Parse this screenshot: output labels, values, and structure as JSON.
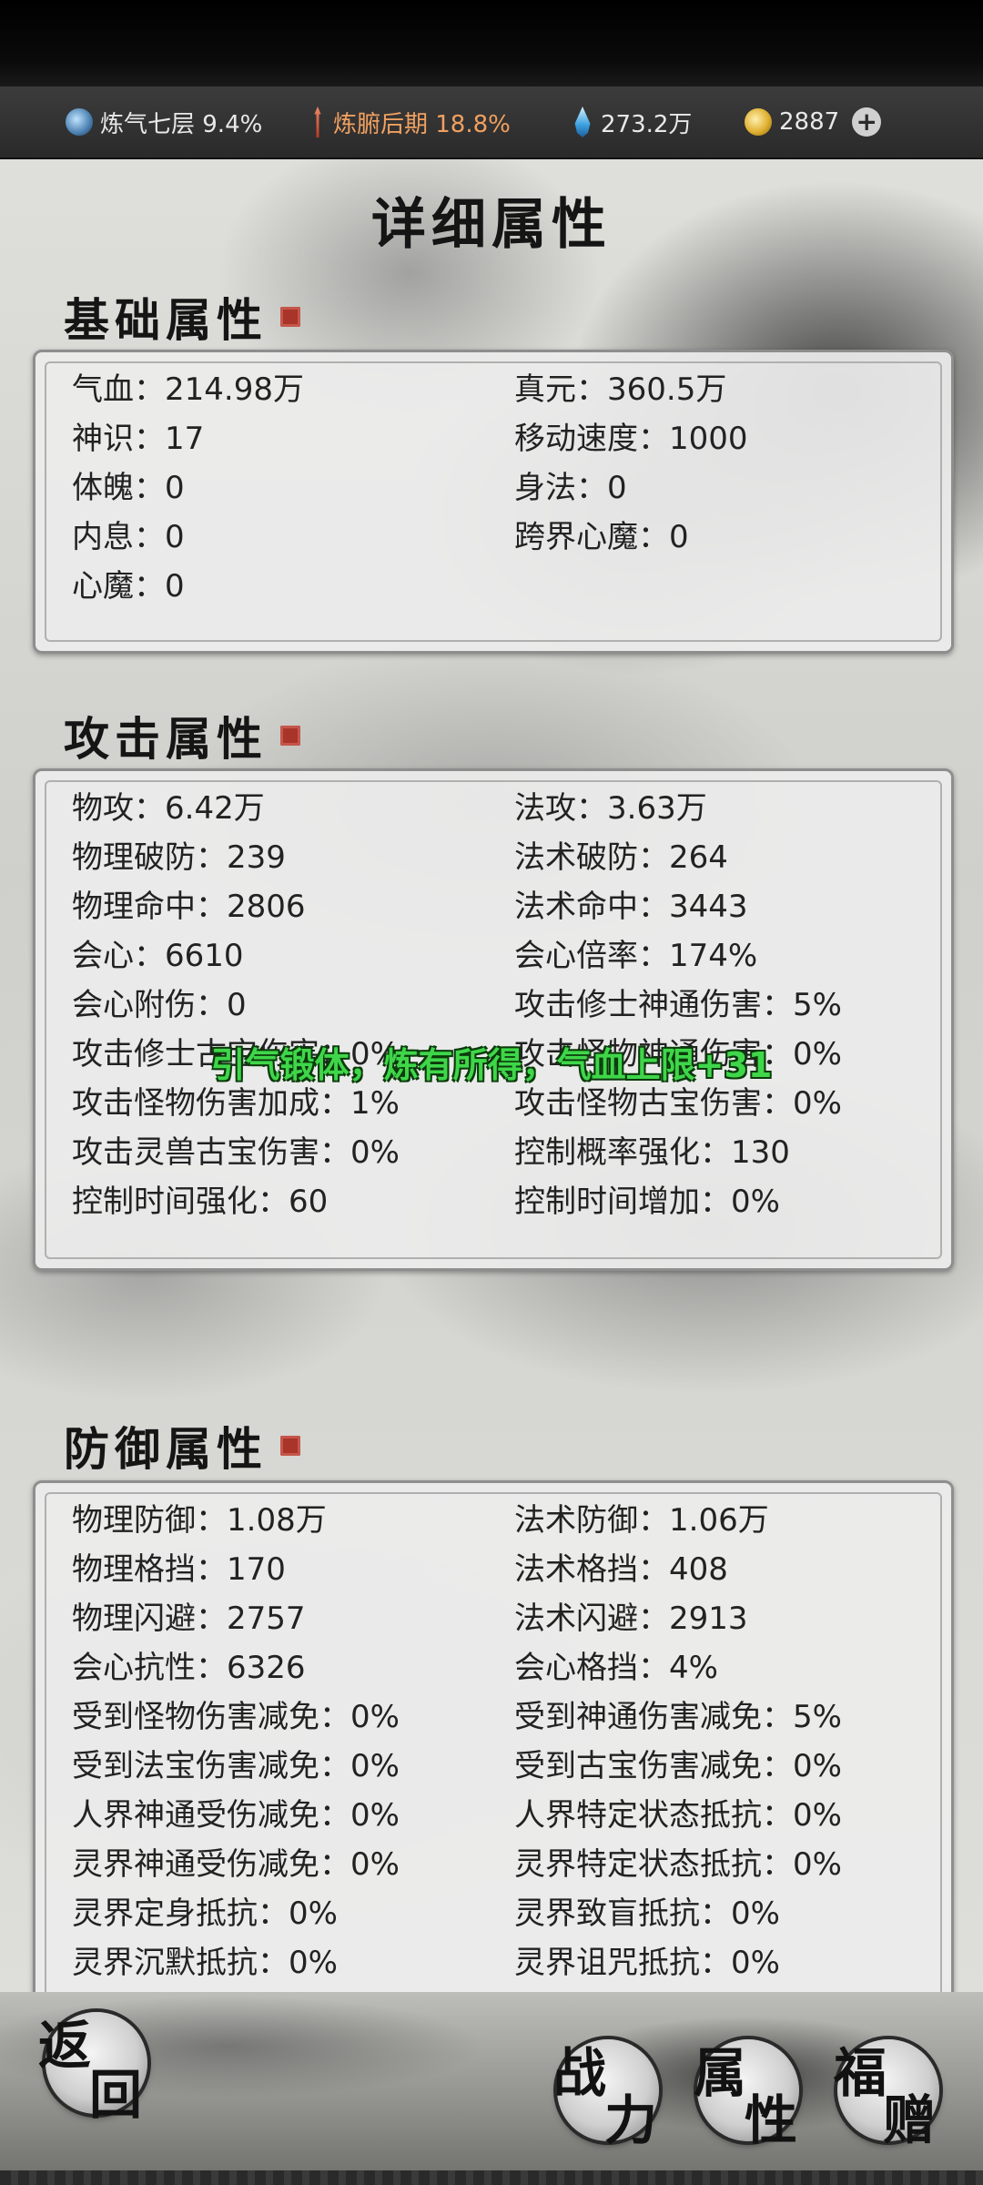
{
  "resources": {
    "cultivation": "炼气七层 9.4%",
    "body_realm": "炼腑后期 18.8%",
    "spirit_stone": "273.2万",
    "coins": "2887"
  },
  "page_title": "详细属性",
  "basic": {
    "title": "基础属性",
    "rows": [
      [
        "气血：214.98万",
        "真元：360.5万"
      ],
      [
        "神识：17",
        "移动速度：1000"
      ],
      [
        "体魄：0",
        "身法：0"
      ],
      [
        "内息：0",
        "跨界心魔：0"
      ],
      [
        "心魔：0",
        ""
      ]
    ]
  },
  "attack": {
    "title": "攻击属性",
    "rows": [
      [
        "物攻：6.42万",
        "法攻：3.63万"
      ],
      [
        "物理破防：239",
        "法术破防：264"
      ],
      [
        "物理命中：2806",
        "法术命中：3443"
      ],
      [
        "会心：6610",
        "会心倍率：174%"
      ],
      [
        "会心附伤：0",
        "攻击修士神通伤害：5%"
      ],
      [
        "攻击修士古宝伤害：0%",
        "攻击怪物神通伤害：0%"
      ],
      [
        "攻击怪物伤害加成：1%",
        "攻击怪物古宝伤害：0%"
      ],
      [
        "攻击灵兽古宝伤害：0%",
        "控制概率强化：130"
      ],
      [
        "控制时间强化：60",
        "控制时间增加：0%"
      ]
    ]
  },
  "toast": "引气锻体，炼有所得，气血上限+31",
  "defense": {
    "title": "防御属性",
    "rows": [
      [
        "物理防御：1.08万",
        "法术防御：1.06万"
      ],
      [
        "物理格挡：170",
        "法术格挡：408"
      ],
      [
        "物理闪避：2757",
        "法术闪避：2913"
      ],
      [
        "会心抗性：6326",
        "会心格挡：4%"
      ],
      [
        "受到怪物伤害减免：0%",
        "受到神通伤害减免：5%"
      ],
      [
        "受到法宝伤害减免：0%",
        "受到古宝伤害减免：0%"
      ],
      [
        "人界神通受伤减免：0%",
        "人界特定状态抵抗：0%"
      ],
      [
        "灵界神通受伤减免：0%",
        "灵界特定状态抵抗：0%"
      ],
      [
        "灵界定身抵抗：0%",
        "灵界致盲抵抗：0%"
      ],
      [
        "灵界沉默抵抗：0%",
        "灵界诅咒抵抗：0%"
      ]
    ]
  },
  "nav": {
    "back_1": "返",
    "back_2": "回",
    "combat_1": "战",
    "combat_2": "力",
    "attr_1": "属",
    "attr_2": "性",
    "gift_1": "福",
    "gift_2": "赠"
  }
}
